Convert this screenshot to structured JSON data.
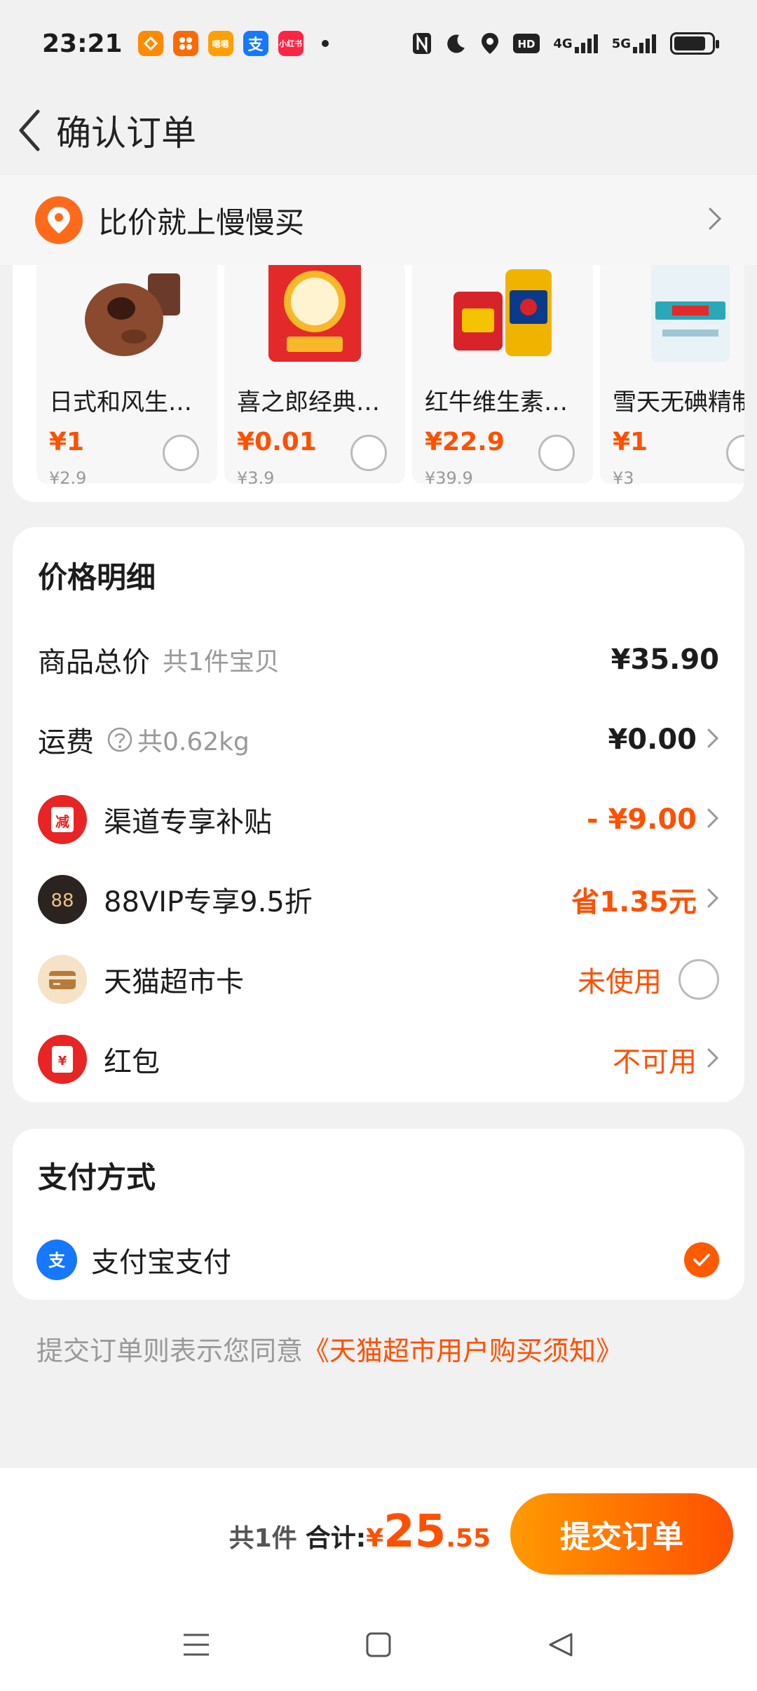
{
  "status_bar": {
    "time": "23:21",
    "apps": [
      {
        "icon": "heart-app-icon",
        "label": "",
        "color": "#ff8a00"
      },
      {
        "icon": "grid-app-icon",
        "label": "",
        "color": "#ff6a00"
      },
      {
        "icon": "ele-app-icon",
        "label": "嗯嗯",
        "color": "#ff9f00"
      },
      {
        "icon": "alipay-app-icon",
        "label": "支",
        "color": "#1677ff"
      },
      {
        "icon": "xiaohongshu-app-icon",
        "label": "小红书",
        "color": "#ff2442"
      }
    ],
    "signal_labels": [
      "4G",
      "5G"
    ],
    "hd_label": "HD"
  },
  "header": {
    "title": "确认订单"
  },
  "banner": {
    "text": "比价就上慢慢买"
  },
  "products": [
    {
      "name": "日式和风生巧…",
      "price": "¥1",
      "original": "¥2.9",
      "icon": "chocolate-cake-icon"
    },
    {
      "name": "喜之郎经典果…",
      "price": "¥0.01",
      "original": "¥3.9",
      "icon": "jelly-pack-icon"
    },
    {
      "name": "红牛维生素饮…",
      "price": "¥22.9",
      "original": "¥39.9",
      "icon": "energy-drink-icon"
    },
    {
      "name": "雪天无碘精制",
      "price": "¥1",
      "original": "¥3",
      "icon": "salt-bag-icon"
    }
  ],
  "price_details": {
    "title": "价格明细",
    "goods_total": {
      "label": "商品总价",
      "sub": "共1件宝贝",
      "value": "¥35.90"
    },
    "shipping": {
      "label": "运费",
      "sub": "共0.62kg",
      "value": "¥0.00"
    },
    "channel_subsidy": {
      "label": "渠道专享补贴",
      "value": "- ¥9.00",
      "icon_text": "减"
    },
    "vip": {
      "label": "88VIP专享9.5折",
      "value": "省1.35元",
      "icon_text": "88"
    },
    "supermarket_card": {
      "label": "天猫超市卡",
      "value": "未使用"
    },
    "red_packet": {
      "label": "红包",
      "value": "不可用",
      "icon_text": "¥"
    }
  },
  "payment": {
    "title": "支付方式",
    "method": "支付宝支付",
    "icon_text": "支"
  },
  "agreement": {
    "prefix": "提交订单则表示您同意",
    "link": "《天猫超市用户购买须知》"
  },
  "bottom": {
    "count": "共1件",
    "total_label": "合计:",
    "yen": "¥",
    "total_int": "25",
    "total_dec": ".55",
    "submit": "提交订单"
  },
  "colors": {
    "accent": "#ff5000",
    "page_bg": "#f1f1f1"
  }
}
